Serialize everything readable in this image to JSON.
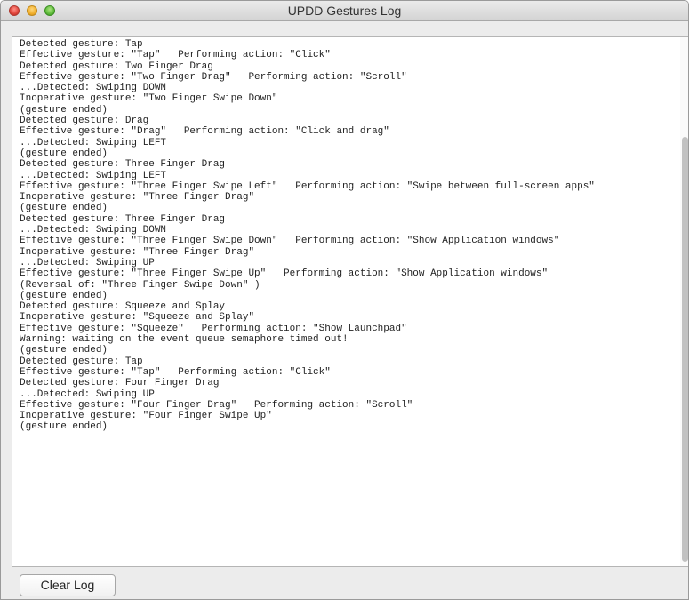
{
  "window": {
    "title": "UPDD Gestures Log"
  },
  "log": {
    "lines": [
      "Detected gesture: Tap",
      "Effective gesture: \"Tap\"   Performing action: \"Click\"",
      "Detected gesture: Two Finger Drag",
      "Effective gesture: \"Two Finger Drag\"   Performing action: \"Scroll\"",
      "...Detected: Swiping DOWN",
      "Inoperative gesture: \"Two Finger Swipe Down\"",
      "(gesture ended)",
      "Detected gesture: Drag",
      "Effective gesture: \"Drag\"   Performing action: \"Click and drag\"",
      "...Detected: Swiping LEFT",
      "(gesture ended)",
      "Detected gesture: Three Finger Drag",
      "...Detected: Swiping LEFT",
      "Effective gesture: \"Three Finger Swipe Left\"   Performing action: \"Swipe between full-screen apps\"",
      "Inoperative gesture: \"Three Finger Drag\"",
      "(gesture ended)",
      "Detected gesture: Three Finger Drag",
      "...Detected: Swiping DOWN",
      "Effective gesture: \"Three Finger Swipe Down\"   Performing action: \"Show Application windows\"",
      "Inoperative gesture: \"Three Finger Drag\"",
      "...Detected: Swiping UP",
      "Effective gesture: \"Three Finger Swipe Up\"   Performing action: \"Show Application windows\"",
      "(Reversal of: \"Three Finger Swipe Down\" )",
      "(gesture ended)",
      "Detected gesture: Squeeze and Splay",
      "Inoperative gesture: \"Squeeze and Splay\"",
      "Effective gesture: \"Squeeze\"   Performing action: \"Show Launchpad\"",
      "Warning: waiting on the event queue semaphore timed out!",
      "(gesture ended)",
      "Detected gesture: Tap",
      "Effective gesture: \"Tap\"   Performing action: \"Click\"",
      "Detected gesture: Four Finger Drag",
      "...Detected: Swiping UP",
      "Effective gesture: \"Four Finger Drag\"   Performing action: \"Scroll\"",
      "Inoperative gesture: \"Four Finger Swipe Up\"",
      "(gesture ended)"
    ]
  },
  "buttons": {
    "clear_log": "Clear Log"
  }
}
